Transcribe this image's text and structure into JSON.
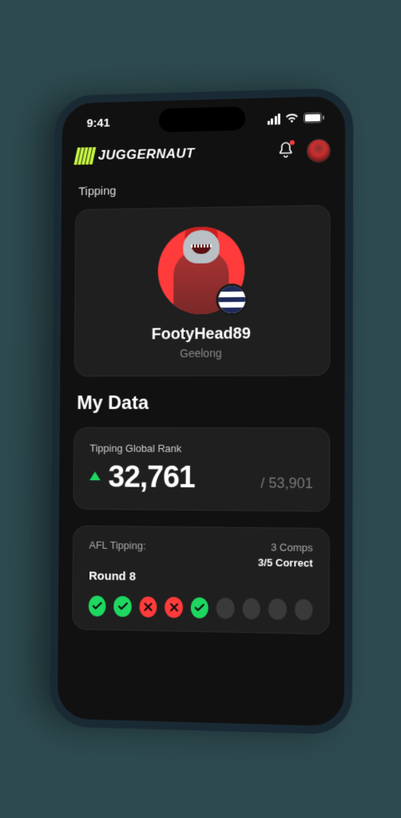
{
  "status": {
    "time": "9:41"
  },
  "brand": {
    "name": "JUGGERNAUT"
  },
  "section": {
    "label": "Tipping"
  },
  "profile": {
    "username": "FootyHead89",
    "team": "Geelong"
  },
  "mydata": {
    "heading": "My Data",
    "rank": {
      "label": "Tipping Global Rank",
      "value": "32,761",
      "total": "/ 53,901",
      "trend": "up"
    }
  },
  "tipping": {
    "league_label": "AFL Tipping:",
    "comps": "3 Comps",
    "correct": "3/5 Correct",
    "round": "Round 8",
    "results": [
      "correct",
      "correct",
      "wrong",
      "wrong",
      "correct",
      "pending",
      "pending",
      "pending",
      "pending"
    ]
  }
}
